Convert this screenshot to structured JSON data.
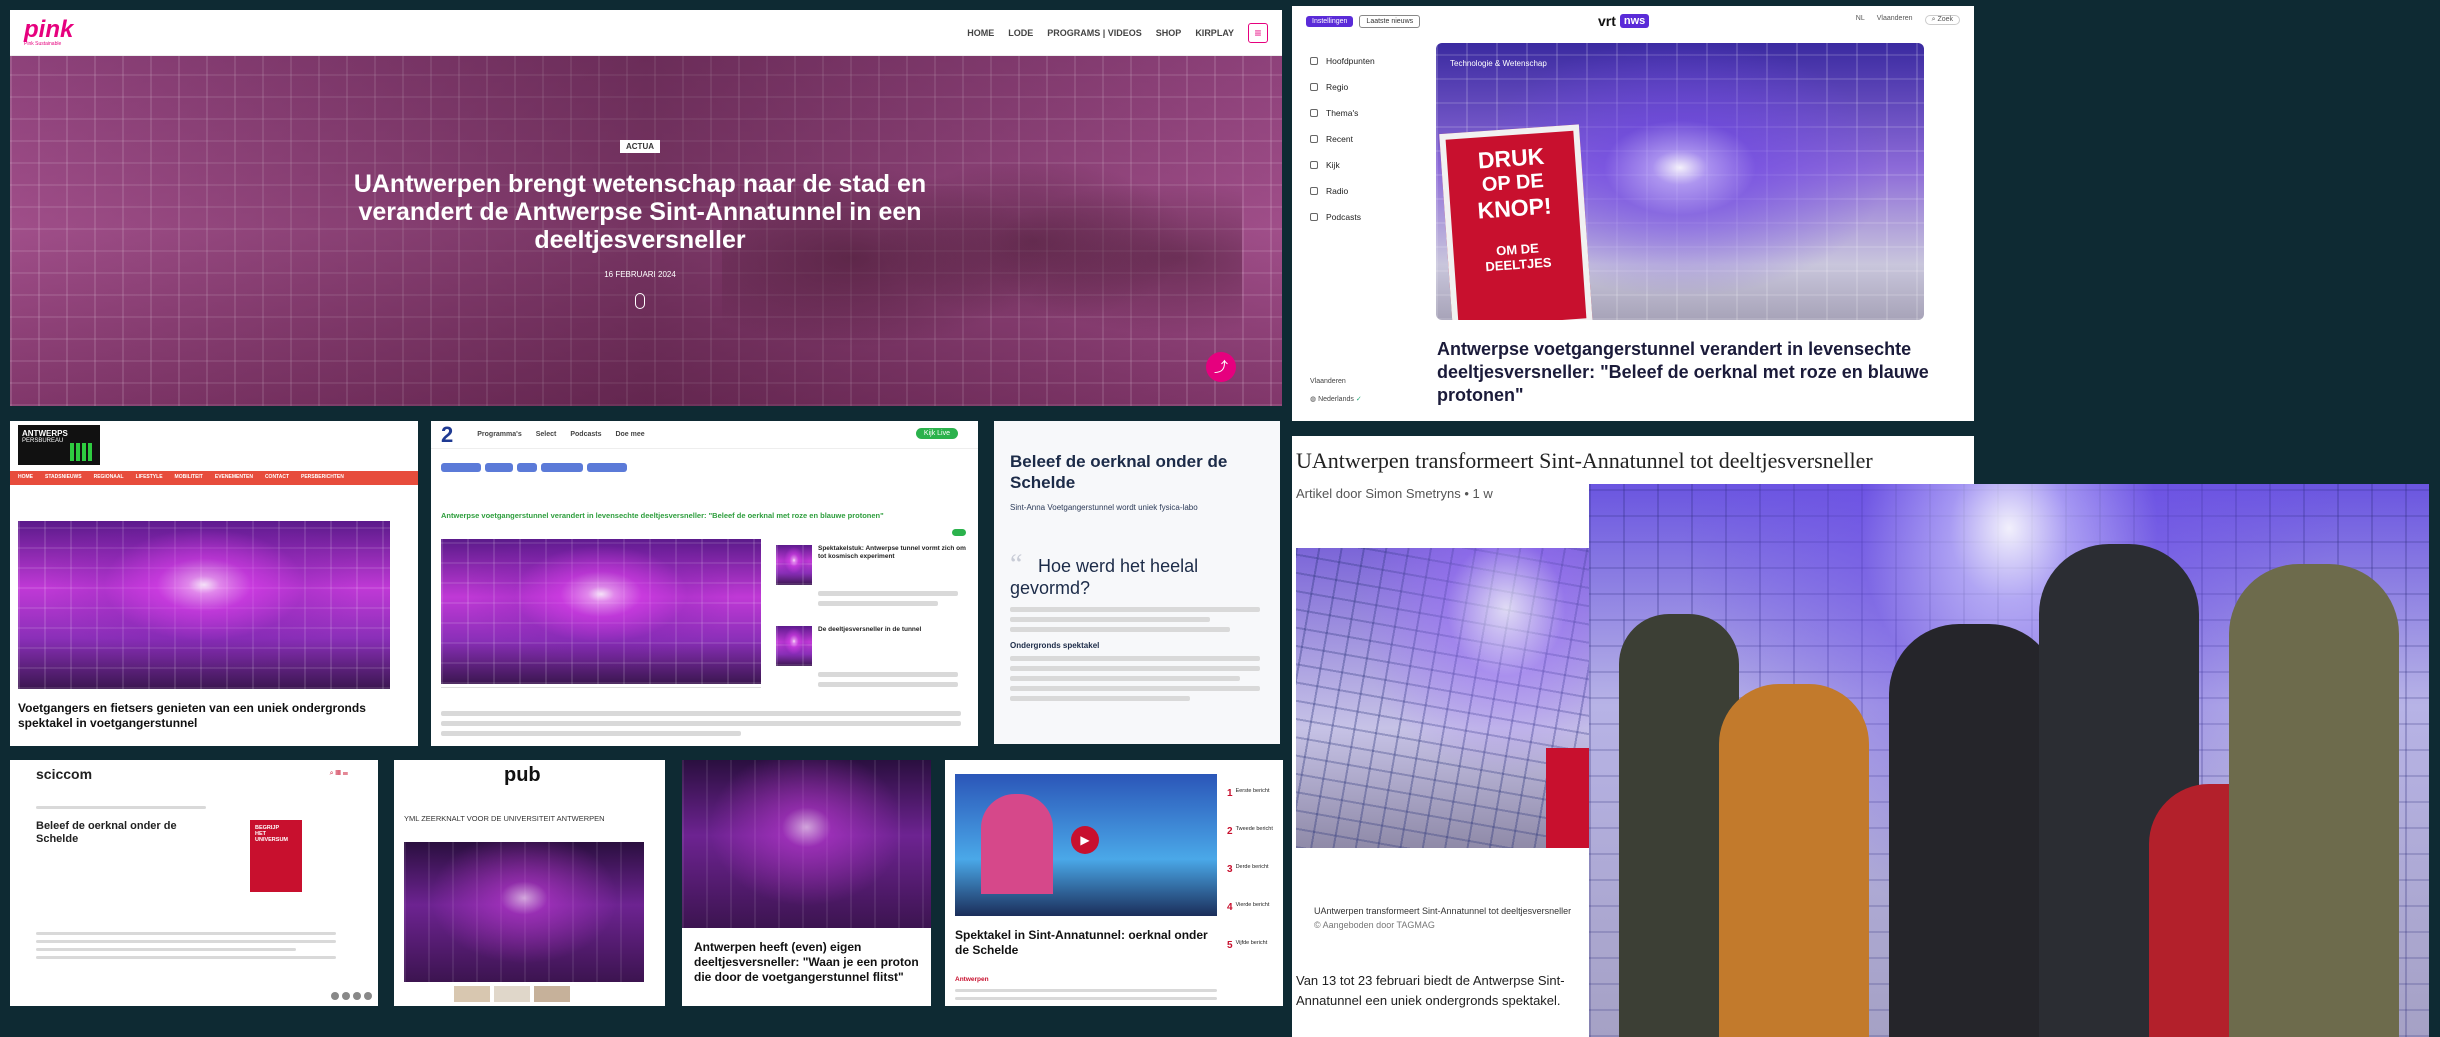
{
  "pink": {
    "logo": "pink",
    "logo_sub": "Pink Sustainable",
    "nav": [
      "HOME",
      "LODE",
      "PROGRAMS | VIDEOS",
      "SHOP",
      "KIRPLAY"
    ],
    "tag": "ACTUA",
    "headline": "UAntwerpen brengt wetenschap naar de stad en verandert de Antwerpse Sint-Annatunnel in een deeltjesversneller",
    "date": "16 FEBRUARI 2024"
  },
  "vrt": {
    "btn_primary": "Instellingen",
    "btn_secondary": "Laatste nieuws",
    "logo_left": "vrt",
    "logo_right": "nws",
    "top_right": [
      "NL",
      "Vlaanderen",
      "Zoek"
    ],
    "sidebar": [
      "Hoofdpunten",
      "Regio",
      "Thema's",
      "Recent",
      "Kijk",
      "Radio",
      "Podcasts"
    ],
    "sidebar_bottom": [
      "Vlaanderen",
      "Nederlands"
    ],
    "image_label": "Technologie & Wetenschap",
    "sign": [
      "DRUK",
      "OP DE",
      "KNOP!",
      "OM DE",
      "DEELTJES"
    ],
    "headline": "Antwerpse voetgangerstunnel verandert in levensechte deeltjesversneller: \"Beleef de oerknal met roze en blauwe protonen\""
  },
  "perskrant": {
    "logo_lines": [
      "ANTWERPS",
      "PERSBUREAU"
    ],
    "menu": [
      "HOME",
      "STADSNIEUWS",
      "REGIONAAL",
      "LIFESTYLE",
      "MOBILITEIT",
      "EVENEMENTEN",
      "CONTACT",
      "PERSBERICHTEN"
    ],
    "headline": "Voetgangers en fietsers genieten van een uniek ondergronds spektakel in voetgangerstunnel"
  },
  "atv": {
    "logo": "2",
    "nav": [
      "Programma's",
      "Select",
      "Podcasts",
      "Doe mee"
    ],
    "cta": "Kijk Live",
    "headline": "Antwerpse voetgangerstunnel verandert in levensechte deeltjesversneller: \"Beleef de oerknal met roze en blauwe protonen\"",
    "side_title_1": "Spektakelstuk: Antwerpse tunnel vormt zich om tot kosmisch experiment",
    "side_title_2": "De deeltjesversneller in de tunnel"
  },
  "oerknal": {
    "title": "Beleef de oerknal onder de Schelde",
    "subtitle": "Sint-Anna Voetgangerstunnel wordt uniek fysica-labo",
    "q_title": "Hoe werd het heelal gevormd?",
    "section": "Ondergronds spektakel"
  },
  "linkedin": {
    "title": "UAntwerpen transformeert Sint-Annatunnel tot deeltjesversneller",
    "byline": "Artikel door Simon Smetryns • 1 w",
    "caption": "UAntwerpen transformeert Sint-Annatunnel tot deeltjesversneller",
    "caption_sub": "© Aangeboden door TAGMAG",
    "body": "Van 13 tot 23 februari biedt de Antwerpse Sint-Annatunnel een uniek ondergronds spektakel. UAntwerpen bouwt in samenwerking"
  },
  "scicom": {
    "logo": "sciccom",
    "headline": "Beleef de oerknal onder de Schelde",
    "book": [
      "BEGRIJP",
      "HET",
      "UNIVERSUM"
    ]
  },
  "pub": {
    "logo": "pub",
    "headline": "YML ZEERKNALT VOOR DE UNIVERSITEIT ANTWERPEN"
  },
  "gva": {
    "headline": "Antwerpen heeft (even) eigen deeltjesversneller: \"Waan je een proton die door de voetgangerstunnel flitst\""
  },
  "nieuws": {
    "headline": "Spektakel in Sint-Annatunnel: oerknal onder de Schelde",
    "lead_label": "Antwerpen",
    "list_numbers": [
      "1",
      "2",
      "3",
      "4",
      "5"
    ],
    "list_items": [
      "Eerste bericht",
      "Tweede bericht",
      "Derde bericht",
      "Vierde bericht",
      "Vijfde bericht"
    ]
  },
  "colors": {
    "brand_pink": "#e6007e",
    "vrt_purple": "#5a2bd8",
    "atv_blue": "#1f3a93",
    "atv_green": "#2bb24c",
    "link_green": "#2e9e3d",
    "news_red": "#c8102e"
  }
}
